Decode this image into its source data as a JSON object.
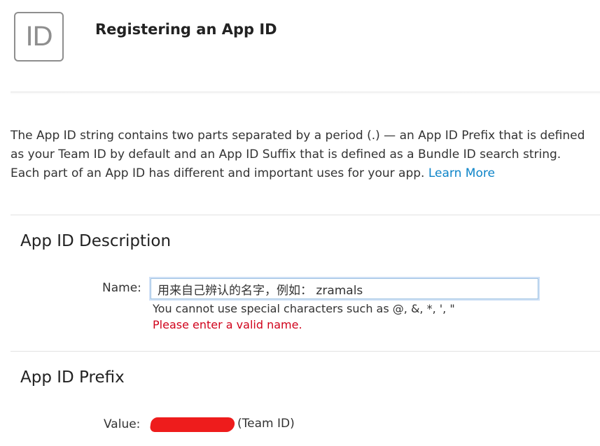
{
  "header": {
    "icon_text": "ID",
    "title": "Registering an App ID"
  },
  "intro": {
    "text": "The App ID string contains two parts separated by a period (.) — an App ID Prefix that is defined as your Team ID by default and an App ID Suffix that is defined as a Bundle ID search string. Each part of an App ID has different and important uses for your app.",
    "link_label": "Learn More"
  },
  "description_section": {
    "heading": "App ID Description",
    "name_label": "Name:",
    "name_value": "用来自己辨认的名字，例如： zramals",
    "hint": "You cannot use special characters such as @, &, *, ', \"",
    "error": "Please enter a valid name."
  },
  "prefix_section": {
    "heading": "App ID Prefix",
    "value_label": "Value:",
    "value_suffix": "(Team ID)"
  },
  "colors": {
    "link": "#0d84c8",
    "error": "#d0021b",
    "redaction": "#ee1c1c"
  }
}
